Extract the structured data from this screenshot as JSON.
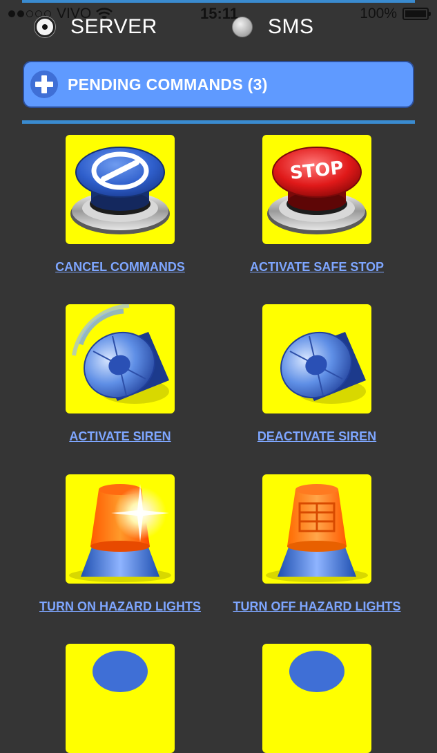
{
  "status_bar": {
    "carrier": "VIVO",
    "time": "15:11",
    "battery": "100%"
  },
  "mode": {
    "options": [
      {
        "label": "SERVER",
        "selected": true
      },
      {
        "label": "SMS",
        "selected": false
      }
    ]
  },
  "pending": {
    "label": "PENDING COMMANDS (3)"
  },
  "commands": [
    {
      "label": "CANCEL COMMANDS",
      "icon": "cancel-button-icon"
    },
    {
      "label": "ACTIVATE SAFE STOP",
      "icon": "stop-button-icon",
      "icon_text": "STOP"
    },
    {
      "label": "ACTIVATE SIREN",
      "icon": "siren-active-icon"
    },
    {
      "label": "DEACTIVATE SIREN",
      "icon": "siren-icon"
    },
    {
      "label": "TURN ON HAZARD LIGHTS",
      "icon": "hazard-light-on-icon"
    },
    {
      "label": "TURN OFF HAZARD LIGHTS",
      "icon": "hazard-light-off-icon"
    }
  ],
  "colors": {
    "background": "#353535",
    "accent_line": "#3a8bd0",
    "pending_bg": "#5f9aff",
    "tile_bg": "#ffff00",
    "link": "#7ea6ff"
  }
}
